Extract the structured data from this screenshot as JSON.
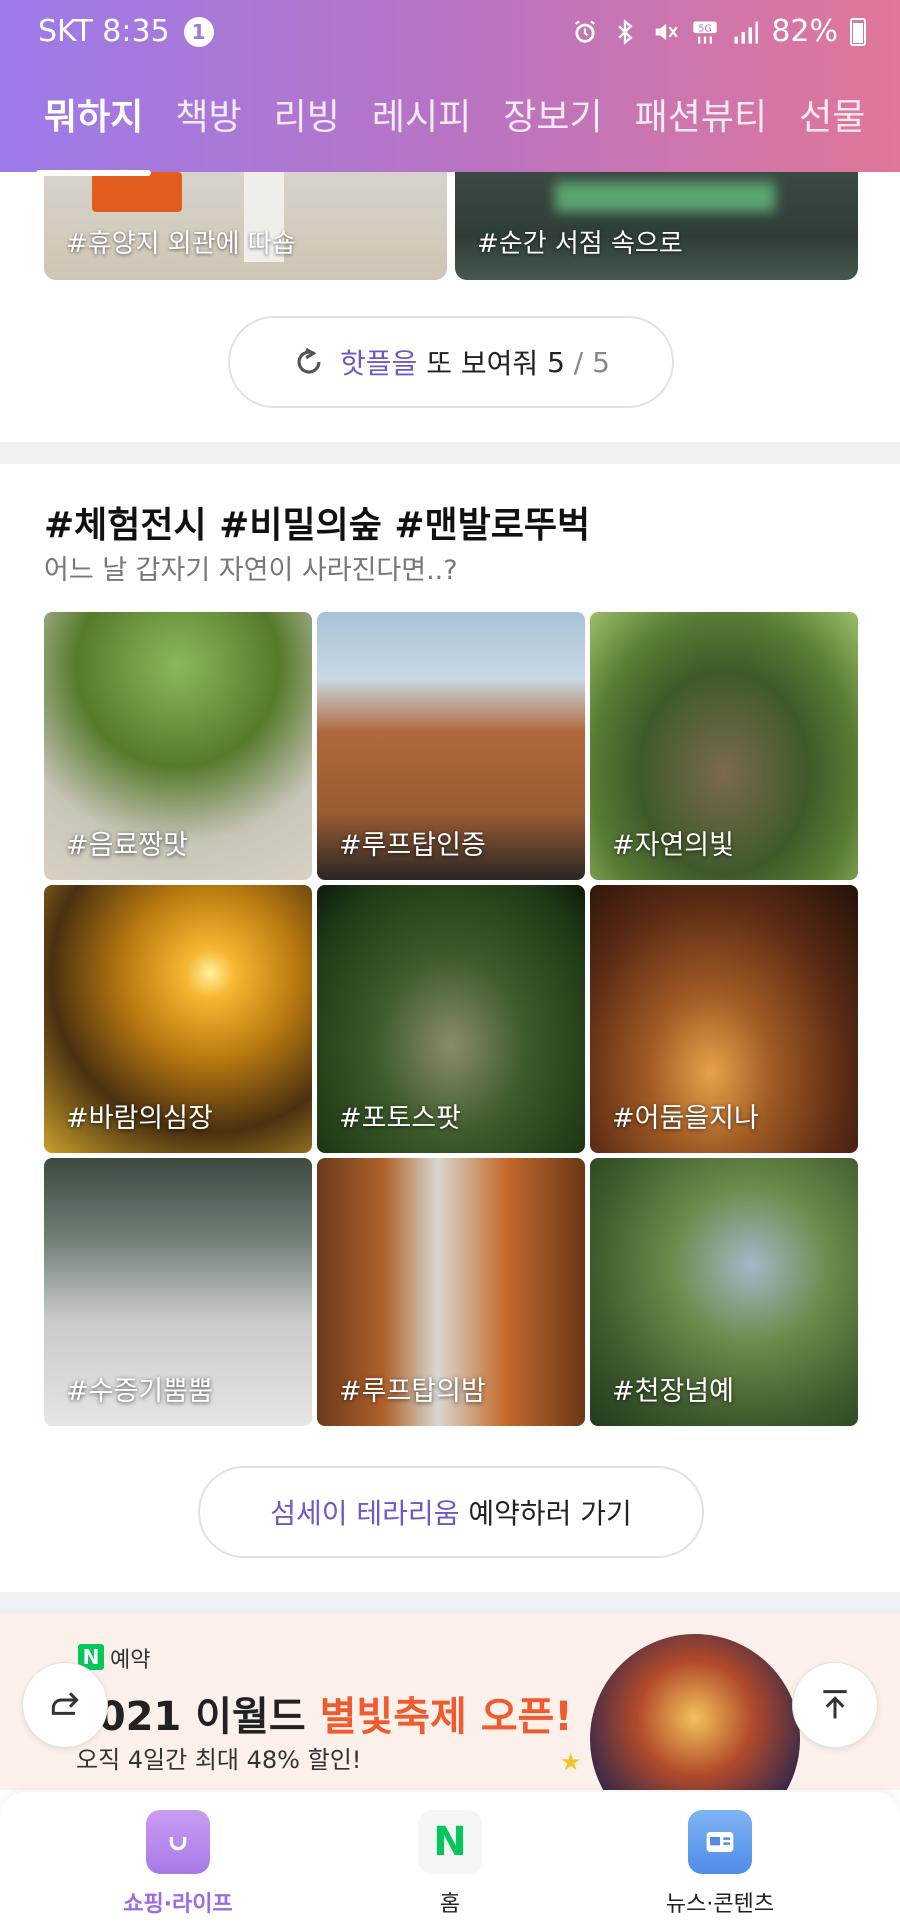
{
  "status": {
    "carrier_time": "SKT 8:35",
    "notification_count": "1",
    "battery": "82%",
    "icons": [
      "alarm-icon",
      "bluetooth-icon",
      "mute-icon",
      "5g-icon",
      "signal-icon",
      "battery-icon"
    ]
  },
  "tabs": [
    {
      "label": "뭐하지",
      "active": true
    },
    {
      "label": "책방"
    },
    {
      "label": "리빙"
    },
    {
      "label": "레시피"
    },
    {
      "label": "장보기"
    },
    {
      "label": "패션뷰티"
    },
    {
      "label": "선물"
    }
  ],
  "top_cards": [
    {
      "caption": "#휴양지 외관에 따숍"
    },
    {
      "caption": "#순간 서점 속으로"
    }
  ],
  "hotplace_button": {
    "accent": "핫플을",
    "text": " 또 보여줘 ",
    "current": "5",
    "total": " / 5"
  },
  "section": {
    "title": "#체험전시 #비밀의숲 #맨발로뚜벅",
    "subtitle": "어느 날 갑자기 자연이 사라진다면..?"
  },
  "grid": [
    {
      "caption": "#음료짱맛"
    },
    {
      "caption": "#루프탑인증"
    },
    {
      "caption": "#자연의빛"
    },
    {
      "caption": "#바람의심장"
    },
    {
      "caption": "#포토스팟"
    },
    {
      "caption": "#어둠을지나"
    },
    {
      "caption": "#수증기뿜뿜"
    },
    {
      "caption": "#루프탑의밤"
    },
    {
      "caption": "#천장넘예"
    }
  ],
  "booking_button": {
    "accent": "섬세이 테라리움",
    "text": " 예약하러 가기"
  },
  "banner": {
    "logo": "N",
    "logo_text": "예약",
    "headline_prefix": "2021 이월드 ",
    "headline_highlight": "별빛축제 오픈!",
    "subline": "오직 4일간 최대 48% 할인!"
  },
  "bottom_nav": [
    {
      "label": "쇼핑·라이프",
      "active": true,
      "icon": "shopping-bag-icon"
    },
    {
      "label": "홈",
      "icon": "naver-n-icon",
      "glyph": "N"
    },
    {
      "label": "뉴스·콘텐츠",
      "icon": "news-card-icon"
    }
  ],
  "colors": {
    "header_gradient": [
      "#9c7bea",
      "#e07699"
    ],
    "accent": "#6f57c9",
    "highlight": "#ef5a2e",
    "naver_green": "#03c75a"
  }
}
